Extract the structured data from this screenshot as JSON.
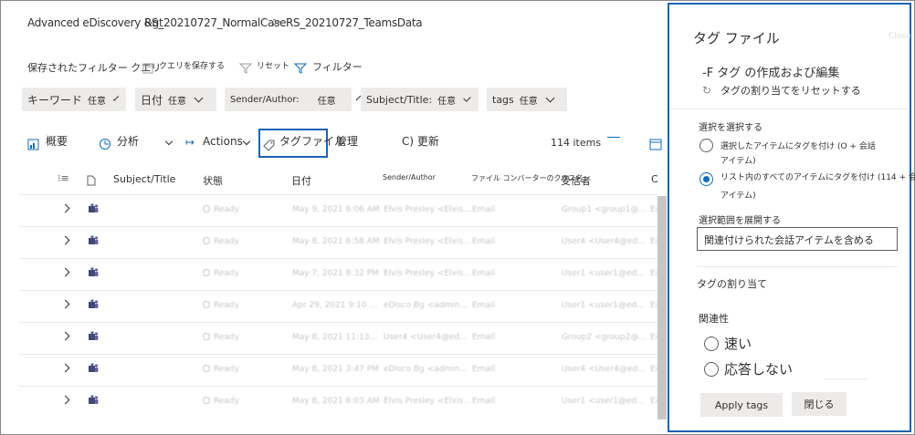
{
  "breadcrumb": {
    "part1": "Advanced eDiscovery &gt",
    "part2": "RS_20210727_NormalCase",
    "part3": "RS_20210727_TeamsData",
    "sep": ">"
  },
  "filter_bar": {
    "saved_query": "保存されたフィルター クエリ",
    "save_query": "クエリを保存する",
    "reset": "リセット",
    "filter": "フィルター"
  },
  "filters": [
    {
      "label": "キーワード",
      "value": "任意"
    },
    {
      "label": "日付",
      "value": "任意"
    },
    {
      "label": "Sender/Author:",
      "value": "任意"
    },
    {
      "label": "Subject/Title:",
      "value": "任意"
    },
    {
      "label": "tags",
      "value": "任意"
    }
  ],
  "toolbar": {
    "overview": "概要",
    "analysis": "分析",
    "actions": "Actions",
    "tag_files": "タグファイル",
    "manage": "管理",
    "refresh": "C) 更新",
    "count": "114 items"
  },
  "table": {
    "headers": [
      "Subject/Title",
      "状態",
      "日付",
      "Sender/Author",
      "ファイル コンバーターのクラス名",
      "受信者",
      "C"
    ],
    "rows": [
      {
        "status": "Ready",
        "date": "May 9, 2021 6:06 AM",
        "sender": "Elvis Presley <Elvis...",
        "type": "Email",
        "recipient": "Group1 <group1@...",
        "extra": "Ei"
      },
      {
        "status": "Ready",
        "date": "May 8, 2021 6:58 AM",
        "sender": "Elvis Presley <Elvis...",
        "type": "Email",
        "recipient": "User4 <User4@ed...",
        "extra": "Ei"
      },
      {
        "status": "Ready",
        "date": "May 7, 2021 8:32 PM",
        "sender": "Elvis Presley <Elvis...",
        "type": "Email",
        "recipient": "User1 <user1@ed...",
        "extra": "Ei"
      },
      {
        "status": "Ready",
        "date": "Apr 29, 2021 9:10 ...",
        "sender": "eDisco Bg <admin...",
        "type": "Email",
        "recipient": "User1 <user1@ed...",
        "extra": "Ei"
      },
      {
        "status": "Ready",
        "date": "May 8, 2021 11:13...",
        "sender": "User4 <User4@ed...",
        "type": "Email",
        "recipient": "Group2 <group2@...",
        "extra": "Ei"
      },
      {
        "status": "Ready",
        "date": "May 8, 2021 3:47 PM",
        "sender": "eDisco Bg <admin...",
        "type": "Email",
        "recipient": "User4 <User4@ed...",
        "extra": "Ei"
      },
      {
        "status": "Ready",
        "date": "May 8, 2021 6:03 AM",
        "sender": "Elvis Presley <Elvis...",
        "type": "Email",
        "recipient": "User1 <user1@ed...",
        "extra": "Ei"
      }
    ]
  },
  "panel": {
    "title": "タグ ファイル",
    "close_text": "Close",
    "create_edit": "-F タグ の作成および編集",
    "reset_assign": "タグの割り当てをリセットする",
    "select_heading": "選択を選択する",
    "opt1_line1": "選択したアイテムにタグを付け (O + 会話",
    "opt1_line2": "アイテム)",
    "opt2_line1": "リスト内のすべてのアイテムにタグを付け (114 + 会話",
    "opt2_line2": "アイテム)",
    "expand_heading": "選択範囲を展開する",
    "expand_value": "関連付けられた会話アイテムを含める",
    "assign_heading": "タグの割り当て",
    "relevance_heading": "関連性",
    "relevance_opt1": "速い",
    "relevance_opt2": "応答しない",
    "apply_button": "Apply tags",
    "close_button": "閉じる"
  }
}
